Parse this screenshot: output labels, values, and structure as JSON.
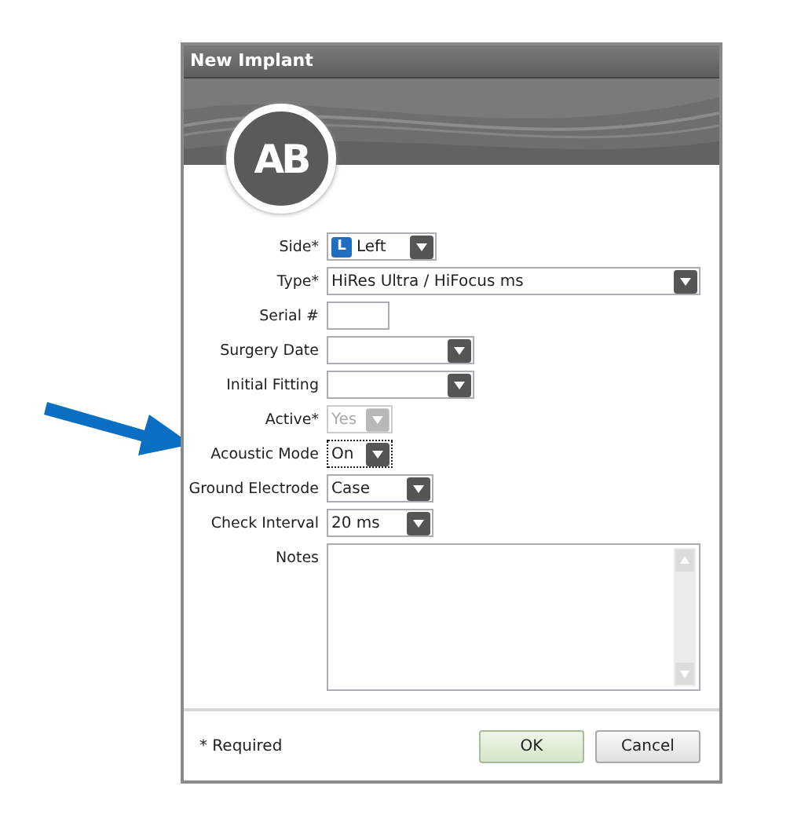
{
  "window": {
    "title": "New Implant"
  },
  "logo": {
    "text": "AB"
  },
  "fields": [
    {
      "kind": "select",
      "label": "Side*",
      "value": "Left",
      "badge": "L",
      "disabled": false,
      "focused": false
    },
    {
      "kind": "select",
      "label": "Type*",
      "value": "HiRes Ultra / HiFocus ms",
      "disabled": false,
      "focused": false
    },
    {
      "kind": "text",
      "label": "Serial #"
    },
    {
      "kind": "select",
      "label": "Surgery Date",
      "disabled": false,
      "focused": false
    },
    {
      "kind": "select",
      "label": "Initial Fitting",
      "disabled": false,
      "focused": false
    },
    {
      "kind": "select",
      "label": "Active*",
      "value": "Yes",
      "disabled": true,
      "focused": false
    },
    {
      "kind": "select",
      "label": "Acoustic Mode",
      "value": "On",
      "disabled": false,
      "focused": true
    },
    {
      "kind": "select",
      "label": "Ground Electrode",
      "value": "Case",
      "disabled": false,
      "focused": false
    },
    {
      "kind": "select",
      "label": "Check Interval",
      "value": "20 ms",
      "disabled": false,
      "focused": false
    },
    {
      "kind": "textarea",
      "label": "Notes"
    }
  ],
  "footer": {
    "note": "* Required",
    "buttons": [
      {
        "label": "OK",
        "primary": true
      },
      {
        "label": "Cancel",
        "primary": false
      }
    ]
  }
}
